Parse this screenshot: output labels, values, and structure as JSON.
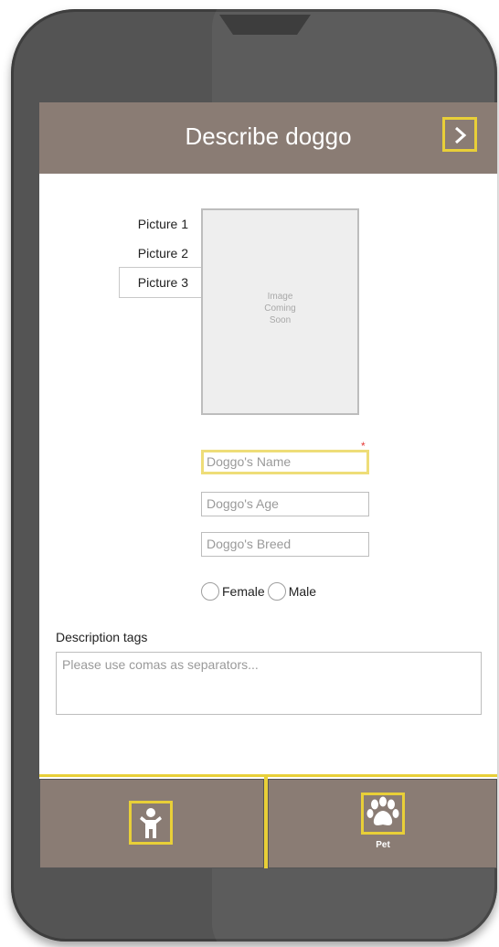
{
  "header": {
    "title": "Describe doggo",
    "next_icon": "chevron-right-icon"
  },
  "pictures": {
    "tabs": [
      "Picture 1",
      "Picture 2",
      "Picture 3"
    ],
    "active_tab": "Picture 3",
    "placeholder": "Image\nComing\nSoon"
  },
  "form": {
    "required_marker": "*",
    "name_placeholder": "Doggo's Name",
    "age_placeholder": "Doggo's Age",
    "breed_placeholder": "Doggo's Breed",
    "gender": {
      "female": "Female",
      "male": "Male"
    },
    "tags_label": "Description tags",
    "tags_placeholder": "Please use comas as separators..."
  },
  "bottom_nav": {
    "person_icon": "person-icon",
    "pet_icon": "paw-icon",
    "pet_label": "Pet"
  },
  "colors": {
    "header_bg": "#8a7c74",
    "accent": "#e8cf38",
    "phone": "#545454"
  }
}
